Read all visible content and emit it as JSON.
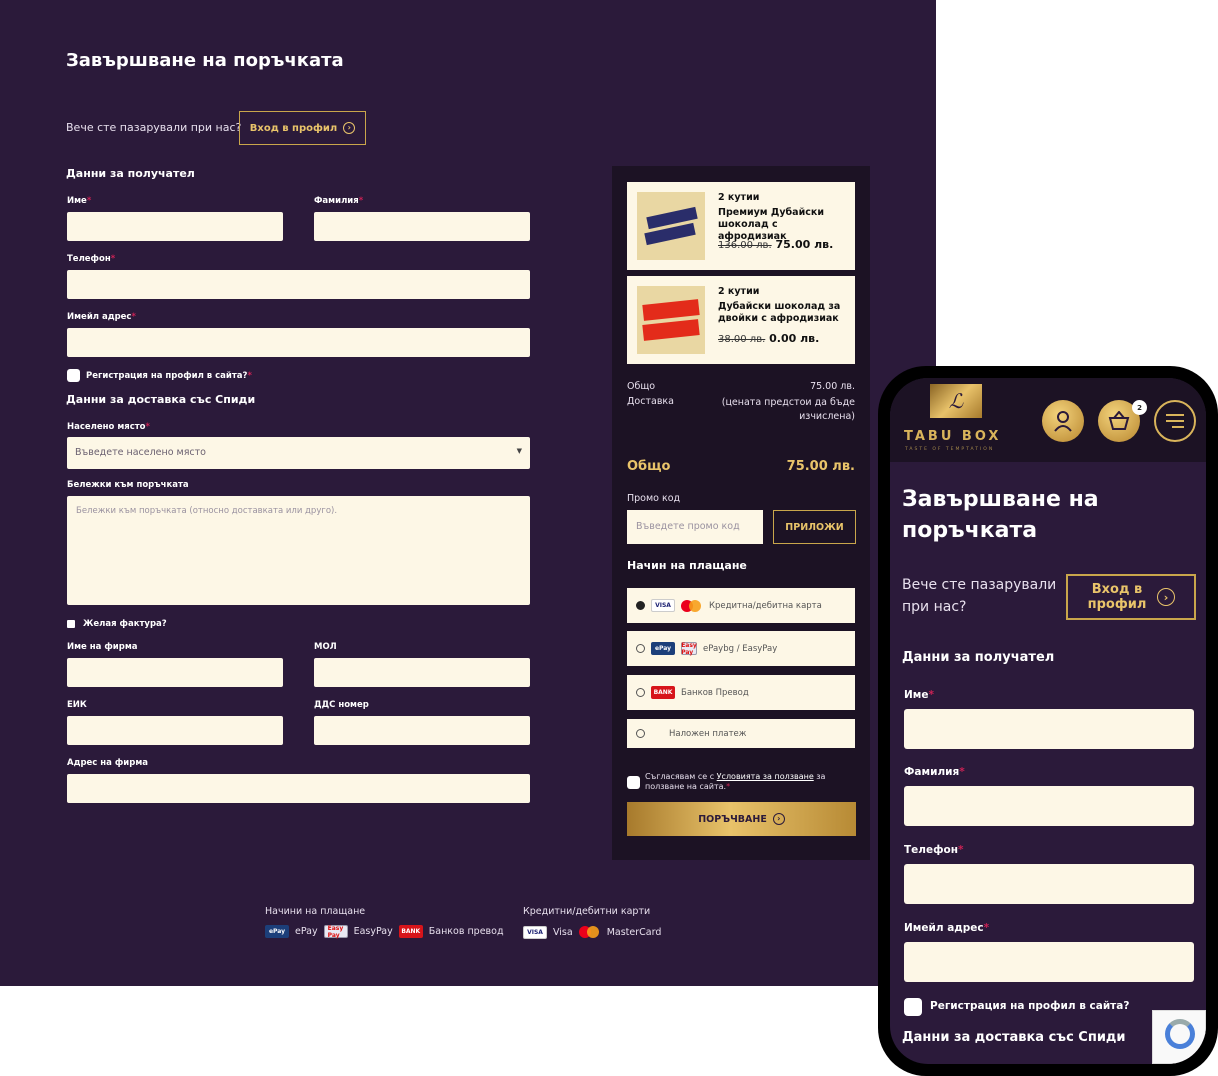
{
  "desktop": {
    "title": "Завършване на поръчката",
    "login_question": "Вече сте пазарували при нас?",
    "login_button": "Вход в профил",
    "recipient_section": "Данни за получател",
    "fields": {
      "first_name": "Име",
      "last_name": "Фамилия",
      "phone": "Телефон",
      "email": "Имейл адрес"
    },
    "register_checkbox": "Регистрация на профил в сайта?",
    "delivery_section": "Данни за доставка със Спиди",
    "settlement_label": "Населено място",
    "settlement_placeholder": "Въведете населено място",
    "notes_label": "Бележки към поръчката",
    "notes_placeholder": "Бележки към поръчката (относно доставката или друго).",
    "invoice_checkbox": "Желая фактура?",
    "company_name": "Име на фирма",
    "mol": "МОЛ",
    "eik": "ЕИК",
    "vat_number": "ДДС номер",
    "company_address": "Адрес на фирма",
    "required_mark": "*"
  },
  "summary": {
    "products": [
      {
        "qty": "2 кутии",
        "name": "Премиум Дубайски шоколад с афродизиак",
        "old_price": "136.00 лв.",
        "price": "75.00 лв."
      },
      {
        "qty": "2 кутии",
        "name": "Дубайски шоколад за двойки с афродизиак",
        "old_price": "38.00 лв.",
        "price": "0.00 лв."
      }
    ],
    "subtotal_label": "Общо",
    "subtotal_value": "75.00 лв.",
    "delivery_label": "Доставка",
    "delivery_value": "(цената предстои да бъде изчислена)",
    "total_label": "Общо",
    "total_value": "75.00 лв.",
    "promo_label": "Промо код",
    "promo_placeholder": "Въведете промо код",
    "promo_button": "ПРИЛОЖИ",
    "payment_title": "Начин на плащане",
    "payments": [
      {
        "label": "Кредитна/дебитна карта",
        "selected": true
      },
      {
        "label": "ePaybg / EasyPay",
        "selected": false
      },
      {
        "label": "Банков Превод",
        "selected": false
      },
      {
        "label": "Наложен платеж",
        "selected": false
      }
    ],
    "terms_prefix": "Съгласявам се с",
    "terms_link": "Условията за ползване",
    "terms_suffix": "за ползване на сайта.",
    "order_button": "ПОРЪЧВАНЕ"
  },
  "footer": {
    "payment_methods_title": "Начини на плащане",
    "cards_title": "Кредитни/дебитни карти",
    "epay": "ePay",
    "easypay": "EasyPay",
    "bank": "Банков превод",
    "visa": "Visa",
    "mastercard": "MasterCard",
    "logo_epay": "ePay",
    "logo_easypay": "Easy Pay",
    "logo_bank": "BANK",
    "logo_visa": "VISA"
  },
  "mobile": {
    "brand": "TABU BOX",
    "tagline": "TASTE OF TEMPTATION",
    "cart_count": "2",
    "title": "Завършване на поръчката",
    "login_question": "Вече сте пазарували при нас?",
    "login_button": "Вход в профил",
    "recipient_section": "Данни за получател",
    "first_name": "Име",
    "last_name": "Фамилия",
    "phone": "Телефон",
    "email": "Имейл адрес",
    "register_checkbox": "Регистрация на профил в сайта?",
    "delivery_section": "Данни за доставка със Спиди"
  },
  "colors": {
    "background": "#2b1a3a",
    "gold": "#e9c46a",
    "field": "#fdf7e6",
    "sidebar": "#1c1224"
  }
}
